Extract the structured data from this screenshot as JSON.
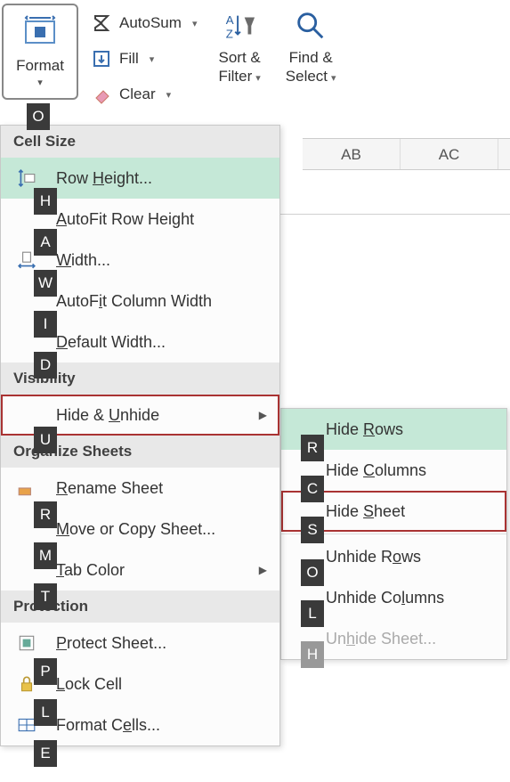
{
  "ribbon": {
    "format_label": "Format",
    "autosum": "AutoSum",
    "fill": "Fill",
    "clear": "Clear",
    "sort_filter": "Sort &\nFilter",
    "find_select": "Find &\nSelect"
  },
  "menu": {
    "sections": {
      "cell_size": "Cell Size",
      "visibility": "Visibility",
      "organize": "Organize Sheets",
      "protection": "Protection"
    },
    "items": {
      "row_height": "Row Height...",
      "autofit_row": "AutoFit Row Height",
      "width": "Width...",
      "autofit_col": "AutoFit Column Width",
      "default_width": "Default Width...",
      "hide_unhide": "Hide & Unhide",
      "rename": "Rename Sheet",
      "move_copy": "Move or Copy Sheet...",
      "tab_color": "Tab Color",
      "protect": "Protect Sheet...",
      "lock": "Lock Cell",
      "format_cells": "Format Cells..."
    }
  },
  "submenu": {
    "hide_rows": "Hide Rows",
    "hide_cols": "Hide Columns",
    "hide_sheet": "Hide Sheet",
    "unhide_rows": "Unhide Rows",
    "unhide_cols": "Unhide Columns",
    "unhide_sheet": "Unhide Sheet..."
  },
  "keys": {
    "format": "O",
    "row_height": "H",
    "autofit_row": "A",
    "width": "W",
    "autofit_col": "I",
    "default_width": "D",
    "hide_unhide": "U",
    "rename": "R",
    "move_copy": "M",
    "tab_color": "T",
    "protect": "P",
    "lock": "L",
    "format_cells": "E",
    "hide_rows": "R",
    "hide_cols": "C",
    "hide_sheet": "S",
    "unhide_rows": "O",
    "unhide_cols": "L",
    "unhide_sheet": "H"
  },
  "columns": [
    "AB",
    "AC"
  ]
}
